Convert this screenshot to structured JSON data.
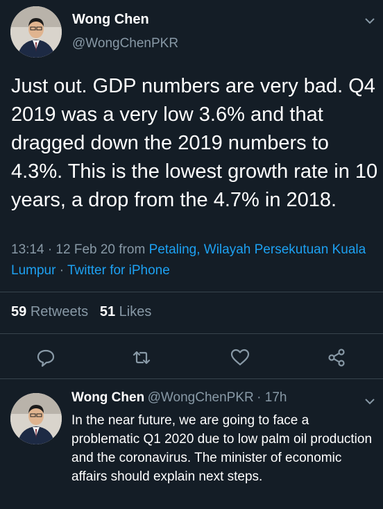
{
  "tweet": {
    "author_name": "Wong Chen",
    "author_handle": "@WongChenPKR",
    "text": "Just out. GDP numbers are very bad. Q4 2019 was a very low 3.6% and that dragged down the 2019 numbers to 4.3%. This is the lowest growth rate in 10 years, a drop from the 4.7% in 2018.",
    "time": "13:14 · 12 Feb 20 from ",
    "location": "Petaling, Wilayah Persekutuan Kuala Lumpur",
    "source_sep": " · ",
    "source": "Twitter for iPhone",
    "retweets_count": "59",
    "retweets_label": "Retweets",
    "likes_count": "51",
    "likes_label": "Likes"
  },
  "actions": {
    "icons": [
      "reply-icon",
      "retweet-icon",
      "like-icon",
      "share-icon"
    ]
  },
  "reply": {
    "author_name": "Wong Chen",
    "author_handle": "@WongChenPKR",
    "age": "· 17h",
    "text": "In the near future, we are going to face a problematic Q1 2020 due to low palm oil production and the coronavirus. The minister of economic affairs should explain next steps."
  },
  "colors": {
    "background": "#141d26",
    "secondary_text": "#8899a6",
    "link": "#1da1f2",
    "divider": "#38444d"
  }
}
